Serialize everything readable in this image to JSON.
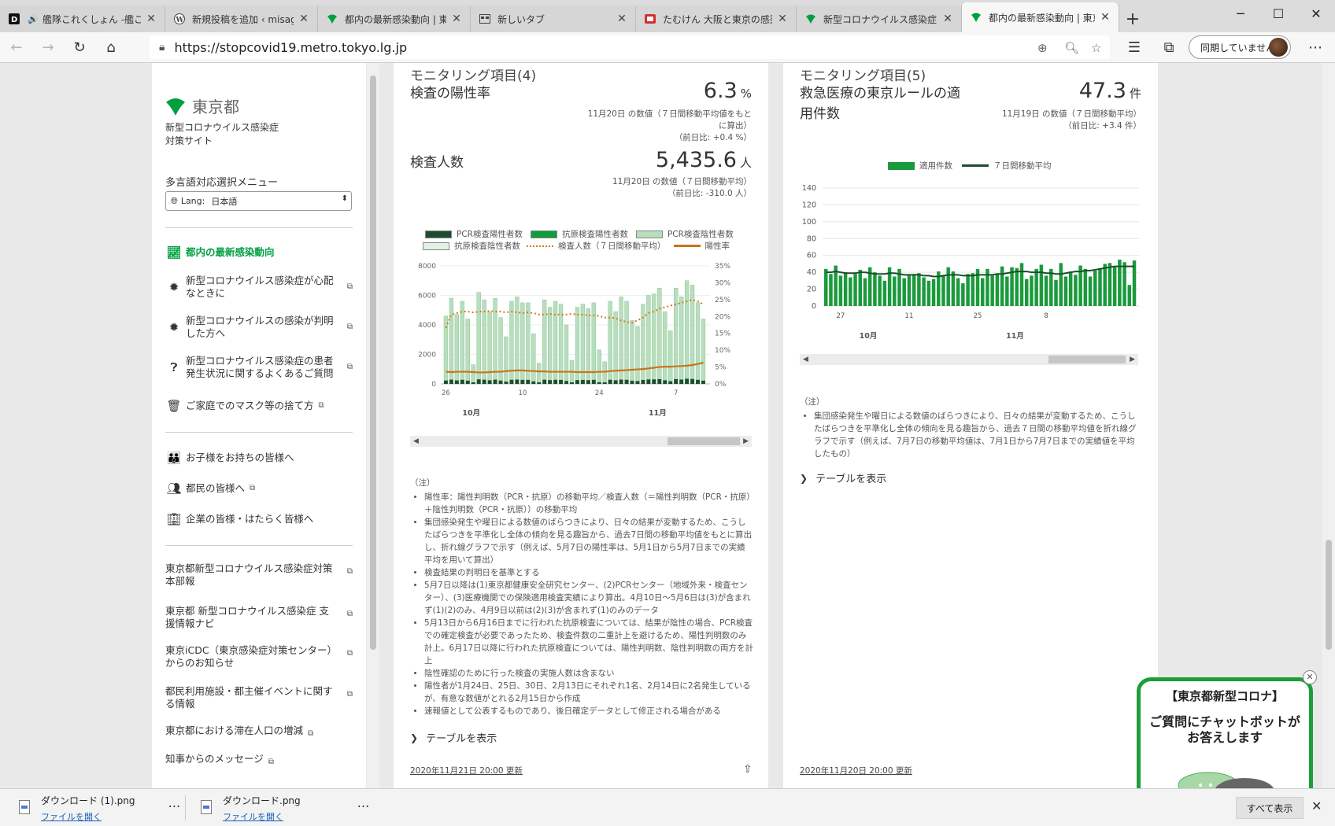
{
  "browser": {
    "tabs": [
      {
        "label": "艦隊これくしょん -艦これ-",
        "icon": "dmm-icon",
        "audio": true
      },
      {
        "label": "新規投稿を追加 ‹ misagoの",
        "icon": "wordpress-icon"
      },
      {
        "label": "都内の最新感染動向 | 東京",
        "icon": "tokyo-ginkgo-icon"
      },
      {
        "label": "新しいタブ",
        "icon": "newtab-icon"
      },
      {
        "label": "たむけん 大阪と東京の感染",
        "icon": "youtube-icon"
      },
      {
        "label": "新型コロナウイルス感染症のP",
        "icon": "tokyo-ginkgo-icon"
      },
      {
        "label": "都内の最新感染動向 | 東京",
        "icon": "tokyo-ginkgo-icon",
        "active": true
      }
    ],
    "url": "https://stopcovid19.metro.tokyo.lg.jp",
    "sync_label": "同期していません"
  },
  "sidebar": {
    "logo_text": "東京都",
    "site_subtitle_1": "新型コロナウイルス感染症",
    "site_subtitle_2": "対策サイト",
    "lang_menu_label": "多言語対応選択メニュー",
    "lang_key": "Lang:",
    "lang_value": "日本語",
    "menu": [
      {
        "label": "都内の最新感染動向",
        "active": true
      },
      {
        "label": "新型コロナウイルス感染症が心配なときに"
      },
      {
        "label": "新型コロナウイルスの感染が判明した方へ"
      },
      {
        "label": "新型コロナウイルス感染症の患者発生状況に関するよくあるご質問"
      },
      {
        "label": "ご家庭でのマスク等の捨て方"
      }
    ],
    "menu2": [
      {
        "label": "お子様をお持ちの皆様へ"
      },
      {
        "label": "都民の皆様へ"
      },
      {
        "label": "企業の皆様・はたらく皆様へ"
      }
    ],
    "links": [
      {
        "label": "東京都新型コロナウイルス感染症対策本部報"
      },
      {
        "label": "東京都 新型コロナウイルス感染症 支援情報ナビ"
      },
      {
        "label": "東京iCDC（東京感染症対策センター）からのお知らせ"
      },
      {
        "label": "都民利用施設・都主催イベントに関する情報"
      },
      {
        "label": "東京都における滞在人口の増減"
      },
      {
        "label": "知事からのメッセージ"
      }
    ]
  },
  "card1": {
    "category": "モニタリング項目(4)",
    "metric1_name": "検査の陽性率",
    "metric1_value": "6.3",
    "metric1_unit": "%",
    "metric1_note_1": "11月20日 の数値（７日間移動平均値をもと",
    "metric1_note_2": "に算出）",
    "metric1_note_3": "（前日比: +0.4 %）",
    "metric2_name": "検査人数",
    "metric2_value": "5,435.6",
    "metric2_unit": "人",
    "metric2_note_1": "11月20日 の数値（７日間移動平均）",
    "metric2_note_2": "（前日比: -310.0 人）",
    "legend": [
      "PCR検査陽性者数",
      "抗原検査陽性者数",
      "PCR検査陰性者数",
      "抗原検査陰性者数",
      "検査人数（７日間移動平均）",
      "陽性率"
    ],
    "notes_head": "（注）",
    "notes": [
      "陽性率：陽性判明数（PCR・抗原）の移動平均／検査人数（＝陽性判明数（PCR・抗原）＋陰性判明数（PCR・抗原））の移動平均",
      "集団感染発生や曜日による数値のばらつきにより、日々の結果が変動するため、こうしたばらつきを平準化し全体の傾向を見る趣旨から、過去7日間の移動平均値をもとに算出し、折れ線グラフで示す（例えば、5月7日の陽性率は、5月1日から5月7日までの実績平均を用いて算出）",
      "検査結果の判明日を基準とする",
      "5月7日以降は(1)東京都健康安全研究センター、(2)PCRセンター（地域外来・検査センター）、(3)医療機関での保険適用検査実績により算出。4月10日～5月6日は(3)が含まれず(1)(2)のみ、4月9日以前は(2)(3)が含まれず(1)のみのデータ",
      "5月13日から6月16日までに行われた抗原検査については、結果が陰性の場合、PCR検査での確定検査が必要であったため、検査件数の二重計上を避けるため、陽性判明数のみ計上。6月17日以降に行われた抗原検査については、陽性判明数、陰性判明数の両方を計上",
      "陰性確認のために行った検査の実施人数は含まない",
      "陽性者が1月24日、25日、30日、2月13日にそれぞれ1名、2月14日に2名発生しているが、有意な数値がとれる2月15日から作成",
      "速報値として公表するものであり、後日確定データとして修正される場合がある"
    ],
    "table_toggle": "テーブルを表示",
    "updated": "2020年11月21日 20:00 更新"
  },
  "card2": {
    "category": "モニタリング項目(5)",
    "metric_name_1": "救急医療の東京ルールの適",
    "metric_name_2": "用件数",
    "metric_value": "47.3",
    "metric_unit": "件",
    "metric_note_1": "11月19日 の数値（７日間移動平均）",
    "metric_note_2": "（前日比: +3.4 件）",
    "legend": [
      "適用件数",
      "７日間移動平均"
    ],
    "notes_head": "（注）",
    "notes": [
      "集団感染発生や曜日による数値のばらつきにより、日々の結果が変動するため、こうしたばらつきを平準化し全体の傾向を見る趣旨から、過去７日間の移動平均値を折れ線グラフで示す（例えば、7月7日の移動平均値は、7月1日から7月7日までの実績値を平均したもの）"
    ],
    "table_toggle": "テーブルを表示",
    "updated": "2020年11月20日 20:00 更新"
  },
  "chart_data": [
    {
      "type": "bar",
      "ylim": [
        0,
        8000
      ],
      "y2lim": [
        0,
        35
      ],
      "yticks": [
        "0",
        "2000",
        "4000",
        "6000",
        "8000"
      ],
      "y2ticks": [
        "0%",
        "5%",
        "10%",
        "15%",
        "20%",
        "25%",
        "30%",
        "35%"
      ],
      "xticks": [
        "26",
        "10",
        "24",
        "7"
      ],
      "month_labels": [
        "10月",
        "11月"
      ],
      "colors": {
        "pcr_pos": "#1d4d2e",
        "antigen_pos": "#0f9d3a",
        "pcr_neg": "#b8dfbd",
        "antigen_neg": "#e2f2e4",
        "test_avg": "#d87a12",
        "pos_rate": "#c8741a"
      },
      "series": [
        {
          "name": "検査人数（７日間移動平均）",
          "values": [
            3800,
            4700,
            4800,
            4900,
            4900,
            4850,
            4900,
            4900,
            4950,
            4900,
            4900,
            4850,
            4900,
            4850,
            4800,
            4850,
            4800,
            4700,
            4700,
            4750,
            4700,
            4700,
            4700,
            4750,
            4700,
            4700,
            4650,
            4650,
            4600,
            4500,
            4500,
            4450,
            4300,
            4200,
            4150,
            4300,
            4500,
            4800,
            4900,
            5100,
            5200,
            5300,
            5400,
            5500,
            5600,
            5700,
            5600,
            5400
          ]
        },
        {
          "name": "陽性率",
          "values": [
            3.6,
            3.5,
            3.6,
            3.6,
            3.6,
            3.5,
            3.4,
            3.4,
            3.5,
            3.6,
            3.6,
            3.8,
            3.9,
            4.0,
            4.0,
            3.9,
            3.8,
            3.7,
            3.7,
            3.6,
            3.6,
            3.6,
            3.6,
            3.6,
            3.5,
            3.5,
            3.5,
            3.5,
            3.6,
            3.6,
            3.8,
            3.9,
            4.0,
            4.1,
            4.2,
            4.3,
            4.4,
            4.6,
            4.8,
            5.0,
            5.1,
            5.1,
            5.2,
            5.3,
            5.4,
            5.6,
            5.9,
            6.3
          ]
        },
        {
          "name": "検査件数合計",
          "values": [
            4600,
            5800,
            4700,
            5600,
            4400,
            1300,
            6200,
            5700,
            4900,
            5800,
            4500,
            3200,
            5600,
            5900,
            5500,
            5500,
            3400,
            1400,
            5700,
            5200,
            5600,
            5400,
            4000,
            1600,
            5200,
            5400,
            5100,
            5500,
            2300,
            1500,
            5600,
            4900,
            5900,
            5600,
            4300,
            3900,
            5400,
            6000,
            6100,
            6500,
            4900,
            3600,
            6500,
            5900,
            7000,
            6700,
            5500,
            4400
          ]
        }
      ]
    },
    {
      "type": "bar",
      "ylim": [
        0,
        140
      ],
      "yticks": [
        "0",
        "20",
        "40",
        "60",
        "80",
        "100",
        "120",
        "140"
      ],
      "xticks": [
        "27",
        "11",
        "25",
        "8"
      ],
      "month_labels": [
        "10月",
        "11月"
      ],
      "colors": {
        "bars": "#1a9a3c",
        "avg": "#1d4d2e"
      },
      "series": [
        {
          "name": "適用件数",
          "values": [
            44,
            38,
            48,
            36,
            40,
            34,
            38,
            43,
            33,
            46,
            40,
            36,
            30,
            46,
            35,
            44,
            33,
            37,
            38,
            39,
            34,
            30,
            32,
            41,
            37,
            46,
            41,
            33,
            27,
            38,
            39,
            44,
            33,
            44,
            36,
            38,
            47,
            35,
            46,
            45,
            51,
            32,
            36,
            44,
            49,
            36,
            44,
            31,
            51,
            35,
            41,
            37,
            48,
            44,
            35,
            42,
            45,
            50,
            51,
            46,
            55,
            52,
            25,
            54
          ]
        },
        {
          "name": "７日間移動平均",
          "values": [
            40,
            40,
            41,
            40,
            39,
            39,
            39,
            40,
            40,
            39,
            38,
            38,
            38,
            39,
            39,
            38,
            37,
            37,
            37,
            37,
            36,
            36,
            35,
            35,
            36,
            37,
            37,
            37,
            36,
            36,
            36,
            37,
            37,
            37,
            37,
            38,
            38,
            39,
            40,
            41,
            41,
            41,
            40,
            40,
            40,
            39,
            39,
            38,
            38,
            39,
            40,
            41,
            41,
            42,
            42,
            43,
            44,
            45,
            46,
            47,
            47,
            47,
            47,
            47
          ]
        }
      ]
    }
  ],
  "chatbot": {
    "title": "【東京都新型コロナ】",
    "line1": "ご質問にチャットボットが",
    "line2": "お答えします"
  },
  "downloads": [
    {
      "name": "ダウンロード (1).png",
      "action": "ファイルを開く"
    },
    {
      "name": "ダウンロード.png",
      "action": "ファイルを開く"
    }
  ],
  "download_show_all": "すべて表示"
}
